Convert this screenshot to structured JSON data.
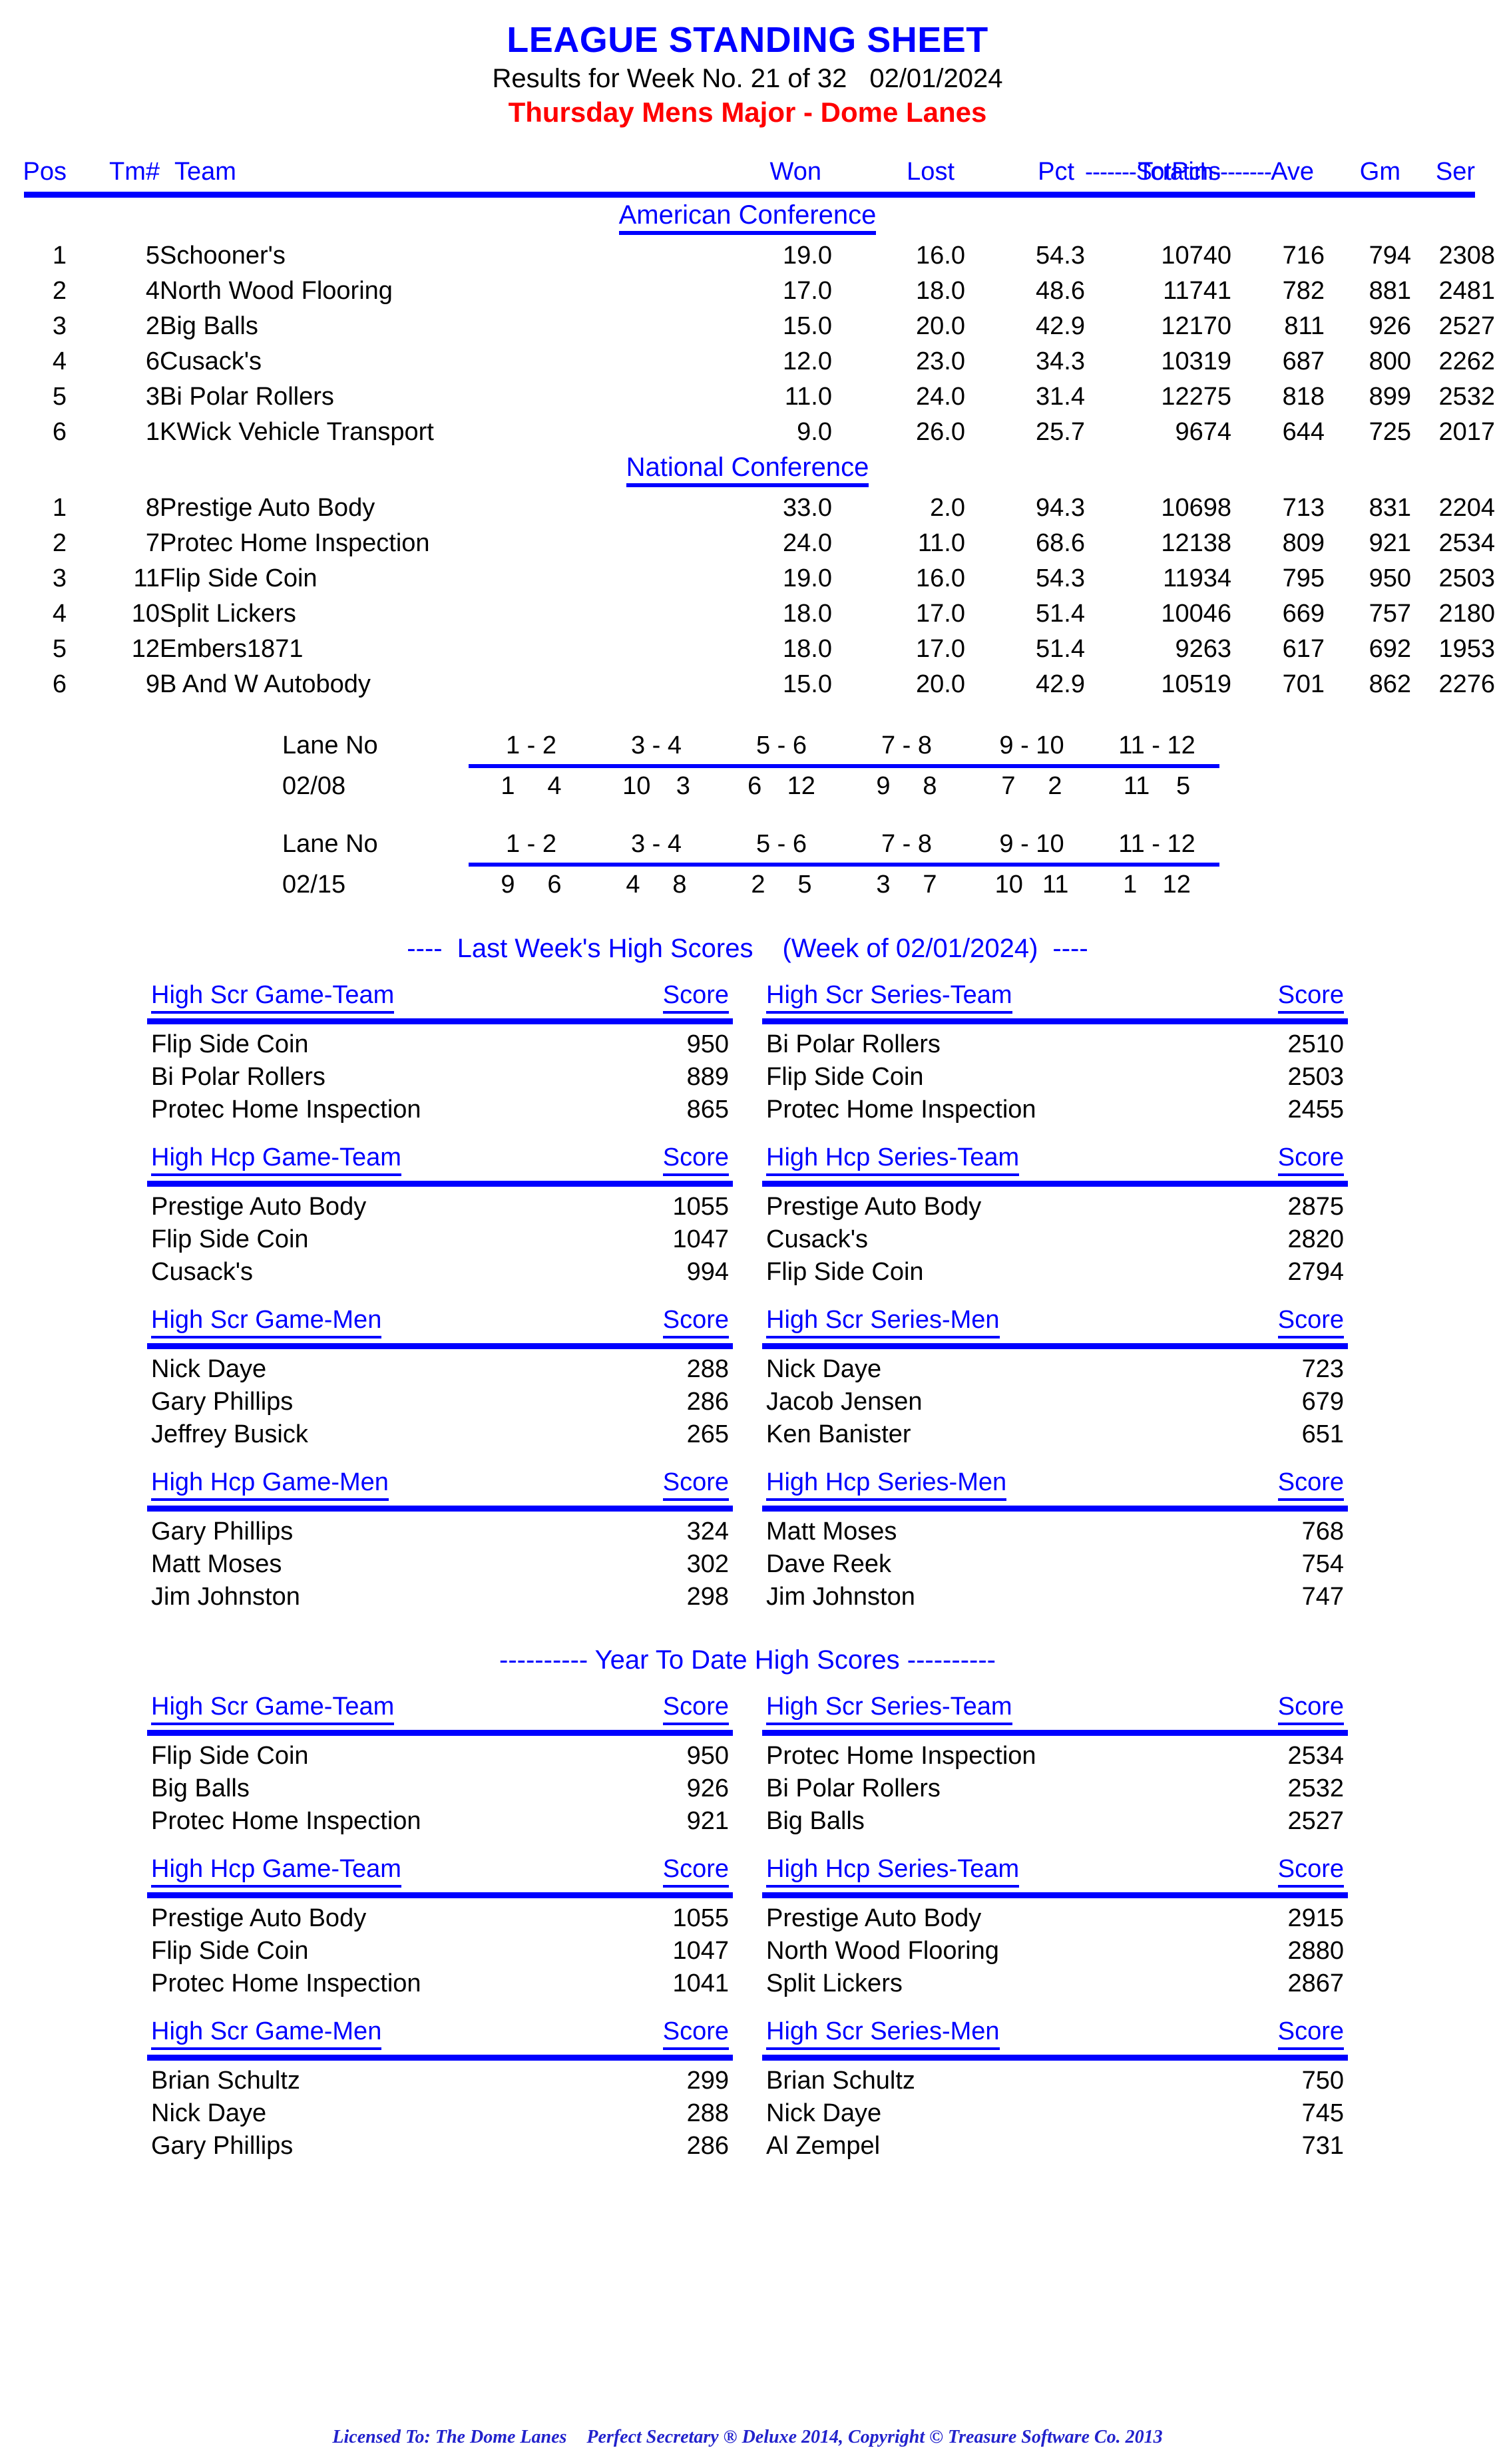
{
  "header": {
    "title": "LEAGUE STANDING SHEET",
    "results_line": "Results for Week No. 21 of 32",
    "results_date": "02/01/2024",
    "league_line": "Thursday Mens Major - Dome Lanes",
    "colors": {
      "title": "#0000FF",
      "league": "#FF0000",
      "accent": "#0000FF",
      "text": "#000000"
    }
  },
  "standings": {
    "scratch_label": "-------Scratch--------",
    "columns": {
      "pos": "Pos",
      "tm": "Tm#",
      "team": "Team",
      "won": "Won",
      "lost": "Lost",
      "pct": "Pct",
      "totpins": "TotPins",
      "ave": "Ave",
      "gm": "Gm",
      "ser": "Ser"
    },
    "conferences": [
      {
        "name": "American Conference",
        "rows": [
          {
            "pos": "1",
            "tm": "5",
            "team": "Schooner's",
            "won": "19.0",
            "lost": "16.0",
            "pct": "54.3",
            "totpins": "10740",
            "ave": "716",
            "gm": "794",
            "ser": "2308"
          },
          {
            "pos": "2",
            "tm": "4",
            "team": "North Wood Flooring",
            "won": "17.0",
            "lost": "18.0",
            "pct": "48.6",
            "totpins": "11741",
            "ave": "782",
            "gm": "881",
            "ser": "2481"
          },
          {
            "pos": "3",
            "tm": "2",
            "team": "Big Balls",
            "won": "15.0",
            "lost": "20.0",
            "pct": "42.9",
            "totpins": "12170",
            "ave": "811",
            "gm": "926",
            "ser": "2527"
          },
          {
            "pos": "4",
            "tm": "6",
            "team": "Cusack's",
            "won": "12.0",
            "lost": "23.0",
            "pct": "34.3",
            "totpins": "10319",
            "ave": "687",
            "gm": "800",
            "ser": "2262"
          },
          {
            "pos": "5",
            "tm": "3",
            "team": "Bi Polar Rollers",
            "won": "11.0",
            "lost": "24.0",
            "pct": "31.4",
            "totpins": "12275",
            "ave": "818",
            "gm": "899",
            "ser": "2532"
          },
          {
            "pos": "6",
            "tm": "1",
            "team": "KWick Vehicle Transport",
            "won": "9.0",
            "lost": "26.0",
            "pct": "25.7",
            "totpins": "9674",
            "ave": "644",
            "gm": "725",
            "ser": "2017"
          }
        ]
      },
      {
        "name": "National Conference",
        "rows": [
          {
            "pos": "1",
            "tm": "8",
            "team": "Prestige Auto Body",
            "won": "33.0",
            "lost": "2.0",
            "pct": "94.3",
            "totpins": "10698",
            "ave": "713",
            "gm": "831",
            "ser": "2204"
          },
          {
            "pos": "2",
            "tm": "7",
            "team": "Protec Home Inspection",
            "won": "24.0",
            "lost": "11.0",
            "pct": "68.6",
            "totpins": "12138",
            "ave": "809",
            "gm": "921",
            "ser": "2534"
          },
          {
            "pos": "3",
            "tm": "11",
            "team": "Flip Side Coin",
            "won": "19.0",
            "lost": "16.0",
            "pct": "54.3",
            "totpins": "11934",
            "ave": "795",
            "gm": "950",
            "ser": "2503"
          },
          {
            "pos": "4",
            "tm": "10",
            "team": "Split Lickers",
            "won": "18.0",
            "lost": "17.0",
            "pct": "51.4",
            "totpins": "10046",
            "ave": "669",
            "gm": "757",
            "ser": "2180"
          },
          {
            "pos": "5",
            "tm": "12",
            "team": "Embers1871",
            "won": "18.0",
            "lost": "17.0",
            "pct": "51.4",
            "totpins": "9263",
            "ave": "617",
            "gm": "692",
            "ser": "1953"
          },
          {
            "pos": "6",
            "tm": "9",
            "team": "B And W Autobody",
            "won": "15.0",
            "lost": "20.0",
            "pct": "42.9",
            "totpins": "10519",
            "ave": "701",
            "gm": "862",
            "ser": "2276"
          }
        ]
      }
    ]
  },
  "lane_schedule": {
    "lane_label": "Lane No",
    "lane_pairs": [
      "1 - 2",
      "3 - 4",
      "5 - 6",
      "7 - 8",
      "9 - 10",
      "11 - 12"
    ],
    "weeks": [
      {
        "date": "02/08",
        "matchups": [
          {
            "a": "1",
            "b": "4"
          },
          {
            "a": "10",
            "b": "3"
          },
          {
            "a": "6",
            "b": "12"
          },
          {
            "a": "9",
            "b": "8"
          },
          {
            "a": "7",
            "b": "2"
          },
          {
            "a": "11",
            "b": "5"
          }
        ]
      },
      {
        "date": "02/15",
        "matchups": [
          {
            "a": "9",
            "b": "6"
          },
          {
            "a": "4",
            "b": "8"
          },
          {
            "a": "2",
            "b": "5"
          },
          {
            "a": "3",
            "b": "7"
          },
          {
            "a": "10",
            "b": "11"
          },
          {
            "a": "1",
            "b": "12"
          }
        ]
      }
    ]
  },
  "last_week": {
    "heading_prefix": "----",
    "heading_main": "Last Week's High Scores",
    "heading_paren": "(Week of 02/01/2024)",
    "heading_suffix": "----",
    "score_label": "Score",
    "groups": [
      {
        "left": {
          "title": "High Scr Game-Team",
          "rows": [
            {
              "name": "Flip Side Coin",
              "value": "950"
            },
            {
              "name": "Bi Polar Rollers",
              "value": "889"
            },
            {
              "name": "Protec Home Inspection",
              "value": "865"
            }
          ]
        },
        "right": {
          "title": "High Scr Series-Team",
          "rows": [
            {
              "name": "Bi Polar Rollers",
              "value": "2510"
            },
            {
              "name": "Flip Side Coin",
              "value": "2503"
            },
            {
              "name": "Protec Home Inspection",
              "value": "2455"
            }
          ]
        }
      },
      {
        "left": {
          "title": "High Hcp Game-Team",
          "rows": [
            {
              "name": "Prestige Auto Body",
              "value": "1055"
            },
            {
              "name": "Flip Side Coin",
              "value": "1047"
            },
            {
              "name": "Cusack's",
              "value": "994"
            }
          ]
        },
        "right": {
          "title": "High Hcp Series-Team",
          "rows": [
            {
              "name": "Prestige Auto Body",
              "value": "2875"
            },
            {
              "name": "Cusack's",
              "value": "2820"
            },
            {
              "name": "Flip Side Coin",
              "value": "2794"
            }
          ]
        }
      },
      {
        "left": {
          "title": "High Scr Game-Men",
          "rows": [
            {
              "name": "Nick Daye",
              "value": "288"
            },
            {
              "name": "Gary Phillips",
              "value": "286"
            },
            {
              "name": "Jeffrey Busick",
              "value": "265"
            }
          ]
        },
        "right": {
          "title": "High Scr Series-Men",
          "rows": [
            {
              "name": "Nick Daye",
              "value": "723"
            },
            {
              "name": "Jacob Jensen",
              "value": "679"
            },
            {
              "name": "Ken Banister",
              "value": "651"
            }
          ]
        }
      },
      {
        "left": {
          "title": "High Hcp Game-Men",
          "rows": [
            {
              "name": "Gary Phillips",
              "value": "324"
            },
            {
              "name": "Matt Moses",
              "value": "302"
            },
            {
              "name": "Jim Johnston",
              "value": "298"
            }
          ]
        },
        "right": {
          "title": "High Hcp Series-Men",
          "rows": [
            {
              "name": "Matt Moses",
              "value": "768"
            },
            {
              "name": "Dave Reek",
              "value": "754"
            },
            {
              "name": "Jim Johnston",
              "value": "747"
            }
          ]
        }
      }
    ]
  },
  "year_to_date": {
    "heading": "---------- Year To Date High Scores ----------",
    "score_label": "Score",
    "groups": [
      {
        "left": {
          "title": "High Scr Game-Team",
          "rows": [
            {
              "name": "Flip Side Coin",
              "value": "950"
            },
            {
              "name": "Big Balls",
              "value": "926"
            },
            {
              "name": "Protec Home Inspection",
              "value": "921"
            }
          ]
        },
        "right": {
          "title": "High Scr Series-Team",
          "rows": [
            {
              "name": "Protec Home Inspection",
              "value": "2534"
            },
            {
              "name": "Bi Polar Rollers",
              "value": "2532"
            },
            {
              "name": "Big Balls",
              "value": "2527"
            }
          ]
        }
      },
      {
        "left": {
          "title": "High Hcp Game-Team",
          "rows": [
            {
              "name": "Prestige Auto Body",
              "value": "1055"
            },
            {
              "name": "Flip Side Coin",
              "value": "1047"
            },
            {
              "name": "Protec Home Inspection",
              "value": "1041"
            }
          ]
        },
        "right": {
          "title": "High Hcp Series-Team",
          "rows": [
            {
              "name": "Prestige Auto Body",
              "value": "2915"
            },
            {
              "name": "North Wood Flooring",
              "value": "2880"
            },
            {
              "name": "Split Lickers",
              "value": "2867"
            }
          ]
        }
      },
      {
        "left": {
          "title": "High Scr Game-Men",
          "rows": [
            {
              "name": "Brian Schultz",
              "value": "299"
            },
            {
              "name": "Nick Daye",
              "value": "288"
            },
            {
              "name": "Gary Phillips",
              "value": "286"
            }
          ]
        },
        "right": {
          "title": "High Scr Series-Men",
          "rows": [
            {
              "name": "Brian Schultz",
              "value": "750"
            },
            {
              "name": "Nick Daye",
              "value": "745"
            },
            {
              "name": "Al Zempel",
              "value": "731"
            }
          ]
        }
      }
    ]
  },
  "footer": {
    "licensed_to": "Licensed To: The Dome Lanes",
    "copyright": "Perfect Secretary ® Deluxe  2014, Copyright © Treasure Software Co. 2013"
  }
}
